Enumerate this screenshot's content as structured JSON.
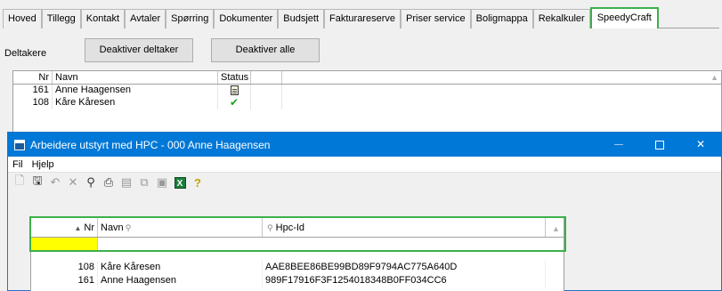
{
  "tabs": [
    "Hoved",
    "Tillegg",
    "Kontakt",
    "Avtaler",
    "Spørring",
    "Dokumenter",
    "Budsjett",
    "Fakturareserve",
    "Priser service",
    "Boligmappa",
    "Rekalkuler",
    "SpeedyCraft"
  ],
  "active_tab": "SpeedyCraft",
  "deltakere": {
    "label": "Deltakere",
    "deactivate_button": "Deaktiver deltaker",
    "deactivate_all_button": "Deaktiver alle",
    "columns": {
      "nr": "Nr",
      "navn": "Navn",
      "status": "Status"
    },
    "rows": [
      {
        "nr": "161",
        "navn": "Anne Haagensen",
        "status_icon": "clipboard-icon"
      },
      {
        "nr": "108",
        "navn": "Kåre Kåresen",
        "status_icon": "checkmark-icon"
      }
    ]
  },
  "dialog": {
    "title": "Arbeidere utstyrt med HPC - 000 Anne Haagensen",
    "menu": [
      "Fil",
      "Hjelp"
    ],
    "toolbar_icons": [
      "new-document-icon",
      "save-icon",
      "undo-icon",
      "delete-icon",
      "find-icon",
      "print-icon",
      "preview-icon",
      "copy-icon",
      "word-export-icon",
      "excel-export-icon",
      "help-icon"
    ],
    "grid": {
      "columns": {
        "nr": "Nr",
        "navn": "Navn",
        "hpc": "Hpc-Id"
      },
      "rows": [
        {
          "nr": "108",
          "navn": "Kåre Kåresen",
          "hpc": "AAE8BEE86BE99BD89F9794AC775A640D"
        },
        {
          "nr": "161",
          "navn": "Anne Haagensen",
          "hpc": "989F17916F3F1254018348B0FF034CC6"
        }
      ]
    }
  },
  "colors": {
    "highlight": "#3cb04a",
    "titlebar": "#0078d7",
    "filter_cell": "#ffff00"
  }
}
